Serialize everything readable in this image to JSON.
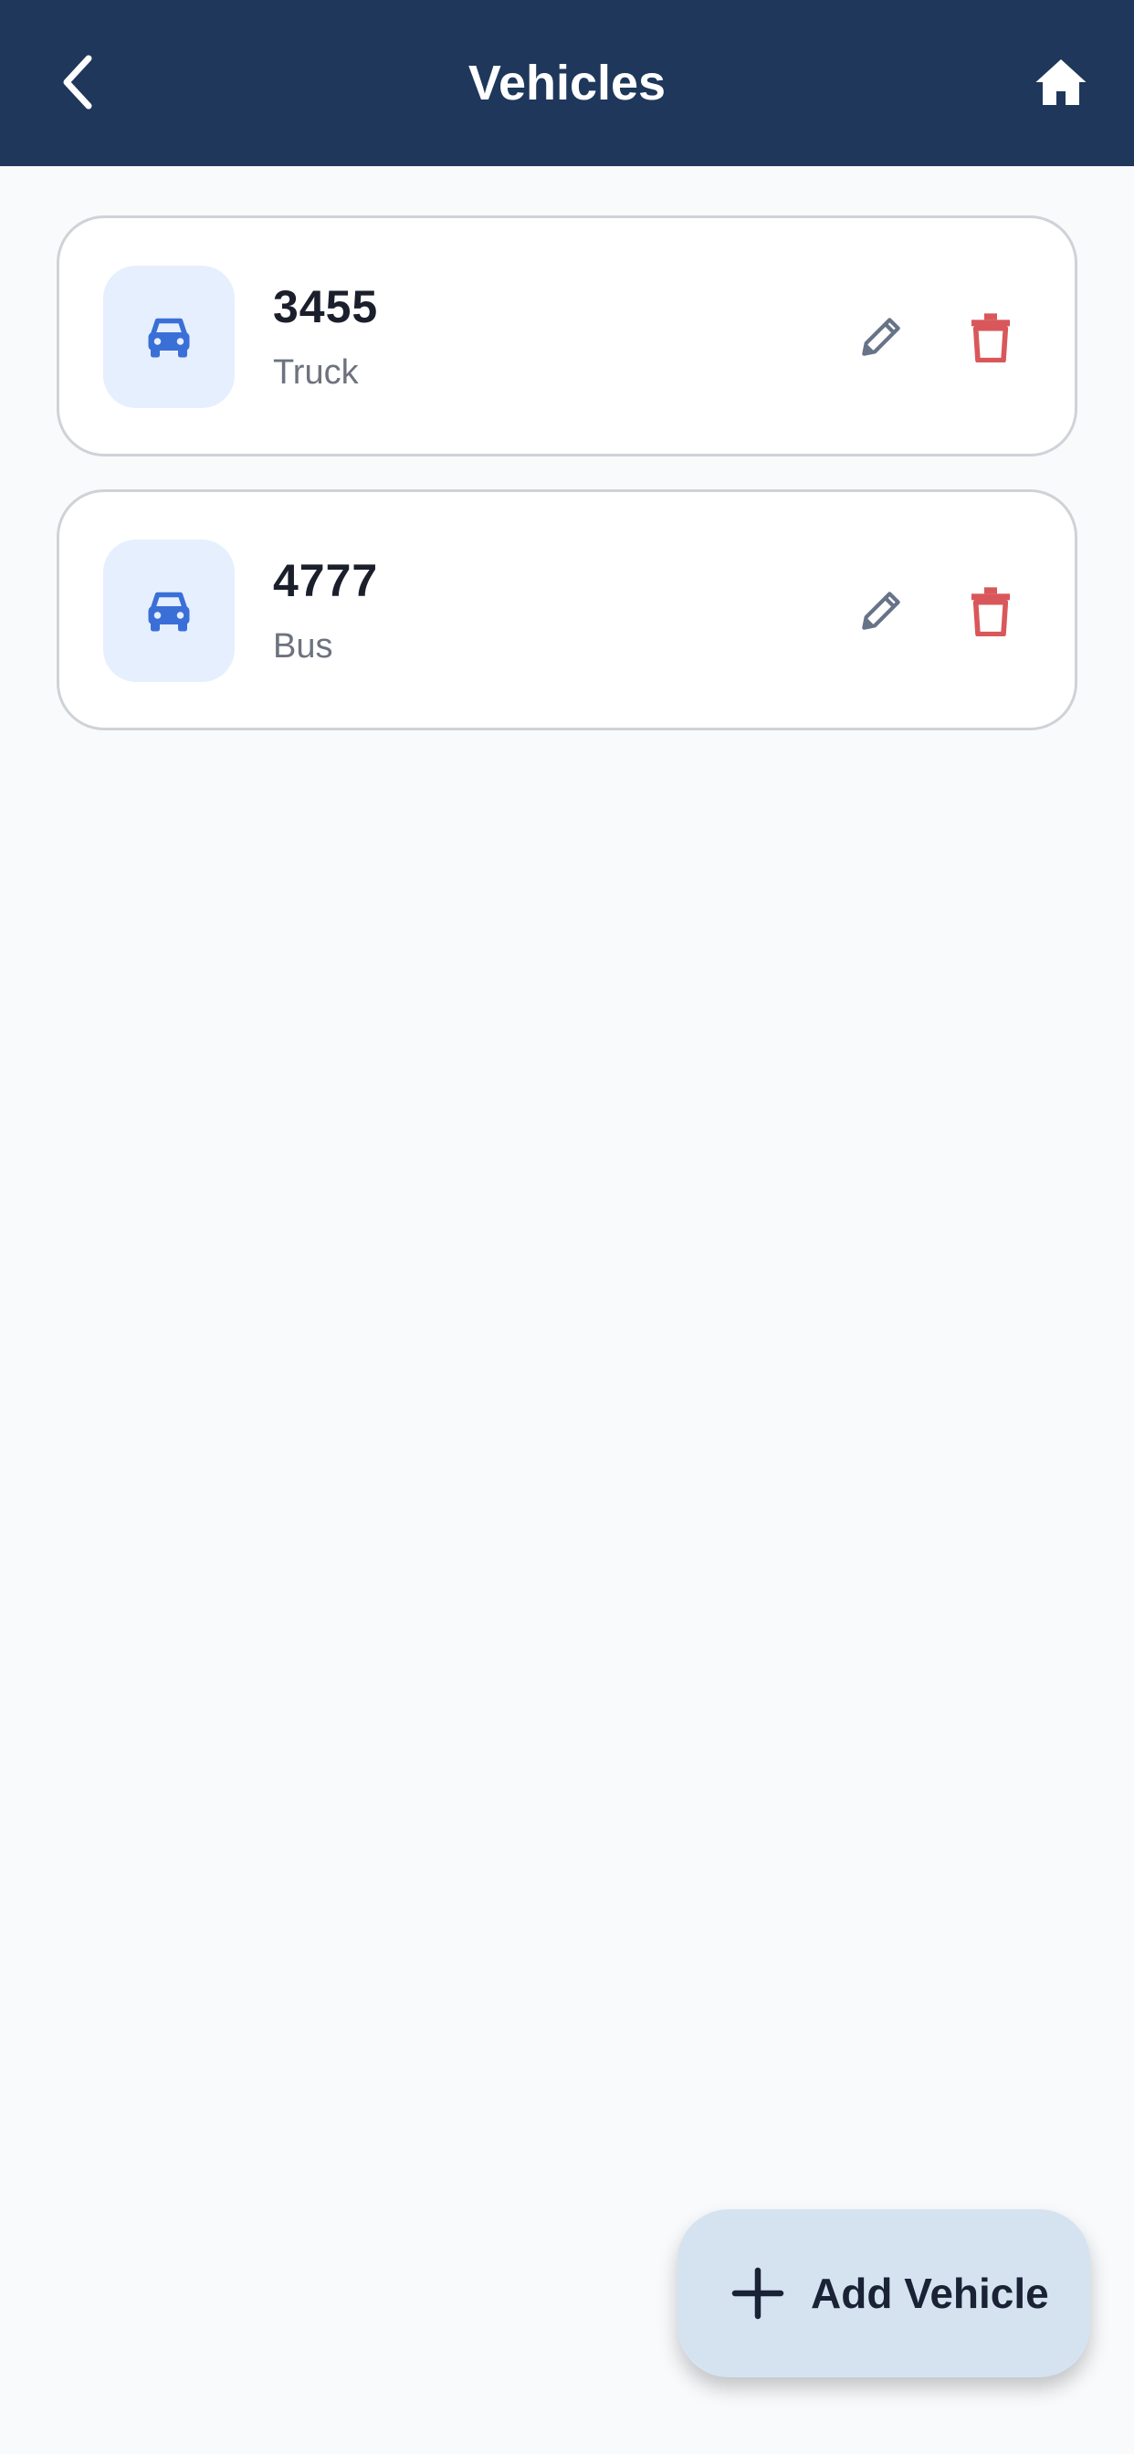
{
  "header": {
    "title": "Vehicles",
    "back_icon": "chevron-left-icon",
    "home_icon": "home-icon",
    "background": "#1e375b"
  },
  "vehicles": [
    {
      "number": "3455",
      "type": "Truck",
      "icon": "car-icon"
    },
    {
      "number": "4777",
      "type": "Bus",
      "icon": "car-icon"
    }
  ],
  "actions": {
    "edit_icon": "pencil-icon",
    "delete_icon": "trash-icon",
    "edit_color": "#667388",
    "delete_color": "#d9575a"
  },
  "fab": {
    "label": "Add Vehicle",
    "icon": "plus-icon",
    "background": "#d5e3f1"
  },
  "colors": {
    "accent": "#3a6fd8",
    "page_background": "#f8fafc"
  }
}
